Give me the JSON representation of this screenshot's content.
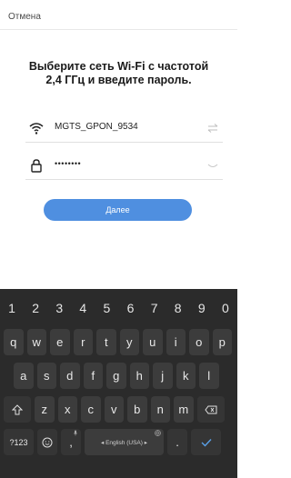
{
  "header": {
    "cancel_label": "Отмена"
  },
  "main": {
    "title": "Выберите сеть Wi-Fi с частотой 2,4 ГГц и введите пароль.",
    "ssid_value": "MGTS_GPON_9534",
    "password_value": "••••••••",
    "next_label": "Далее"
  },
  "keyboard": {
    "number_row": [
      "1",
      "2",
      "3",
      "4",
      "5",
      "6",
      "7",
      "8",
      "9",
      "0"
    ],
    "row1": [
      "q",
      "w",
      "e",
      "r",
      "t",
      "y",
      "u",
      "i",
      "o",
      "p"
    ],
    "row2": [
      "a",
      "s",
      "d",
      "f",
      "g",
      "h",
      "j",
      "k",
      "l"
    ],
    "row3": [
      "z",
      "x",
      "c",
      "v",
      "b",
      "n",
      "m"
    ],
    "symbols_label": "?123",
    "comma_label": ",",
    "period_label": ".",
    "space_label": "◂ English (USA) ▸"
  },
  "colors": {
    "accent": "#4f8fe0",
    "keyboard_bg": "#2b2b2b",
    "key_bg": "#3c3c3c",
    "enter_check": "#5aa0e8"
  },
  "icons": [
    "wifi-icon",
    "swap-icon",
    "lock-icon",
    "eye-hidden-icon",
    "shift-icon",
    "backspace-icon",
    "emoji-icon",
    "check-icon",
    "mic-icon",
    "globe-icon"
  ]
}
